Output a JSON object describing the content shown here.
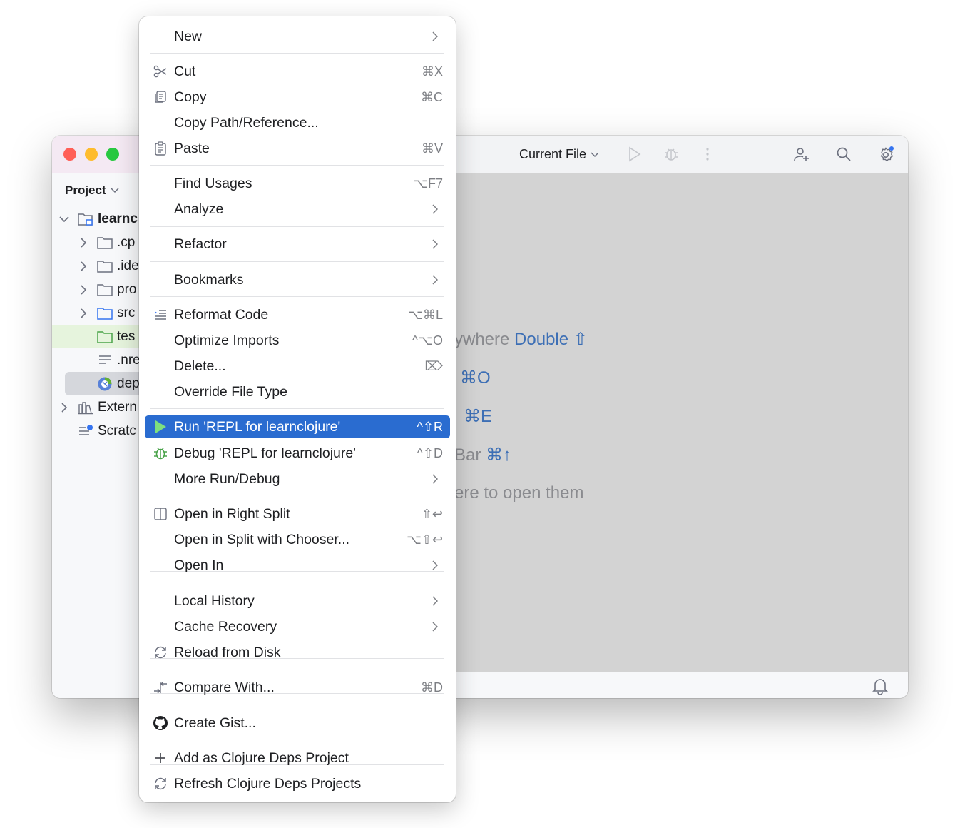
{
  "window": {
    "run_config": "Current File",
    "sidebar_title": "Project",
    "tree": [
      {
        "label": "learnc",
        "bold": true
      },
      {
        "label": ".cp"
      },
      {
        "label": ".ide"
      },
      {
        "label": "pro"
      },
      {
        "label": "src"
      },
      {
        "label": "tes"
      },
      {
        "label": ".nre"
      },
      {
        "label": "dep"
      },
      {
        "label": "Extern"
      },
      {
        "label": "Scratc"
      }
    ],
    "hints": [
      {
        "text": "ywhere ",
        "key": "Double ⇧"
      },
      {
        "text": "",
        "key": "⌘O"
      },
      {
        "text": "",
        "key": "⌘E"
      },
      {
        "text": "Bar ",
        "key": "⌘↑"
      },
      {
        "text": "ere to open them",
        "key": ""
      }
    ]
  },
  "menu": {
    "items": [
      {
        "label": "New",
        "shortcut": "",
        "icon": ""
      },
      {
        "label": "Cut",
        "shortcut": "⌘X",
        "icon": "scissors-icon"
      },
      {
        "label": "Copy",
        "shortcut": "⌘C",
        "icon": "copy-icon"
      },
      {
        "label": "Copy Path/Reference...",
        "shortcut": "",
        "icon": ""
      },
      {
        "label": "Paste",
        "shortcut": "⌘V",
        "icon": "paste-icon"
      },
      {
        "label": "Find Usages",
        "shortcut": "⌥F7",
        "icon": ""
      },
      {
        "label": "Analyze",
        "shortcut": "",
        "icon": ""
      },
      {
        "label": "Refactor",
        "shortcut": "",
        "icon": ""
      },
      {
        "label": "Bookmarks",
        "shortcut": "",
        "icon": ""
      },
      {
        "label": "Reformat Code",
        "shortcut": "⌥⌘L",
        "icon": "reformat-icon"
      },
      {
        "label": "Optimize Imports",
        "shortcut": "^⌥O",
        "icon": ""
      },
      {
        "label": "Delete...",
        "shortcut": "⌦",
        "icon": ""
      },
      {
        "label": "Override File Type",
        "shortcut": "",
        "icon": ""
      },
      {
        "label": "Run 'REPL for learnclojure'",
        "shortcut": "^⇧R",
        "icon": "run-icon"
      },
      {
        "label": "Debug 'REPL for learnclojure'",
        "shortcut": "^⇧D",
        "icon": "debug-icon"
      },
      {
        "label": "More Run/Debug",
        "shortcut": "",
        "icon": ""
      },
      {
        "label": "Open in Right Split",
        "shortcut": "⇧↩",
        "icon": "split-icon"
      },
      {
        "label": "Open in Split with Chooser...",
        "shortcut": "⌥⇧↩",
        "icon": ""
      },
      {
        "label": "Open In",
        "shortcut": "",
        "icon": ""
      },
      {
        "label": "Local History",
        "shortcut": "",
        "icon": ""
      },
      {
        "label": "Cache Recovery",
        "shortcut": "",
        "icon": ""
      },
      {
        "label": "Reload from Disk",
        "shortcut": "",
        "icon": "reload-icon"
      },
      {
        "label": "Compare With...",
        "shortcut": "⌘D",
        "icon": "compare-icon"
      },
      {
        "label": "Create Gist...",
        "shortcut": "",
        "icon": "github-icon"
      },
      {
        "label": "Add as Clojure Deps Project",
        "shortcut": "",
        "icon": "plus-icon"
      },
      {
        "label": "Refresh Clojure Deps Projects",
        "shortcut": "",
        "icon": "refresh-icon"
      }
    ]
  }
}
